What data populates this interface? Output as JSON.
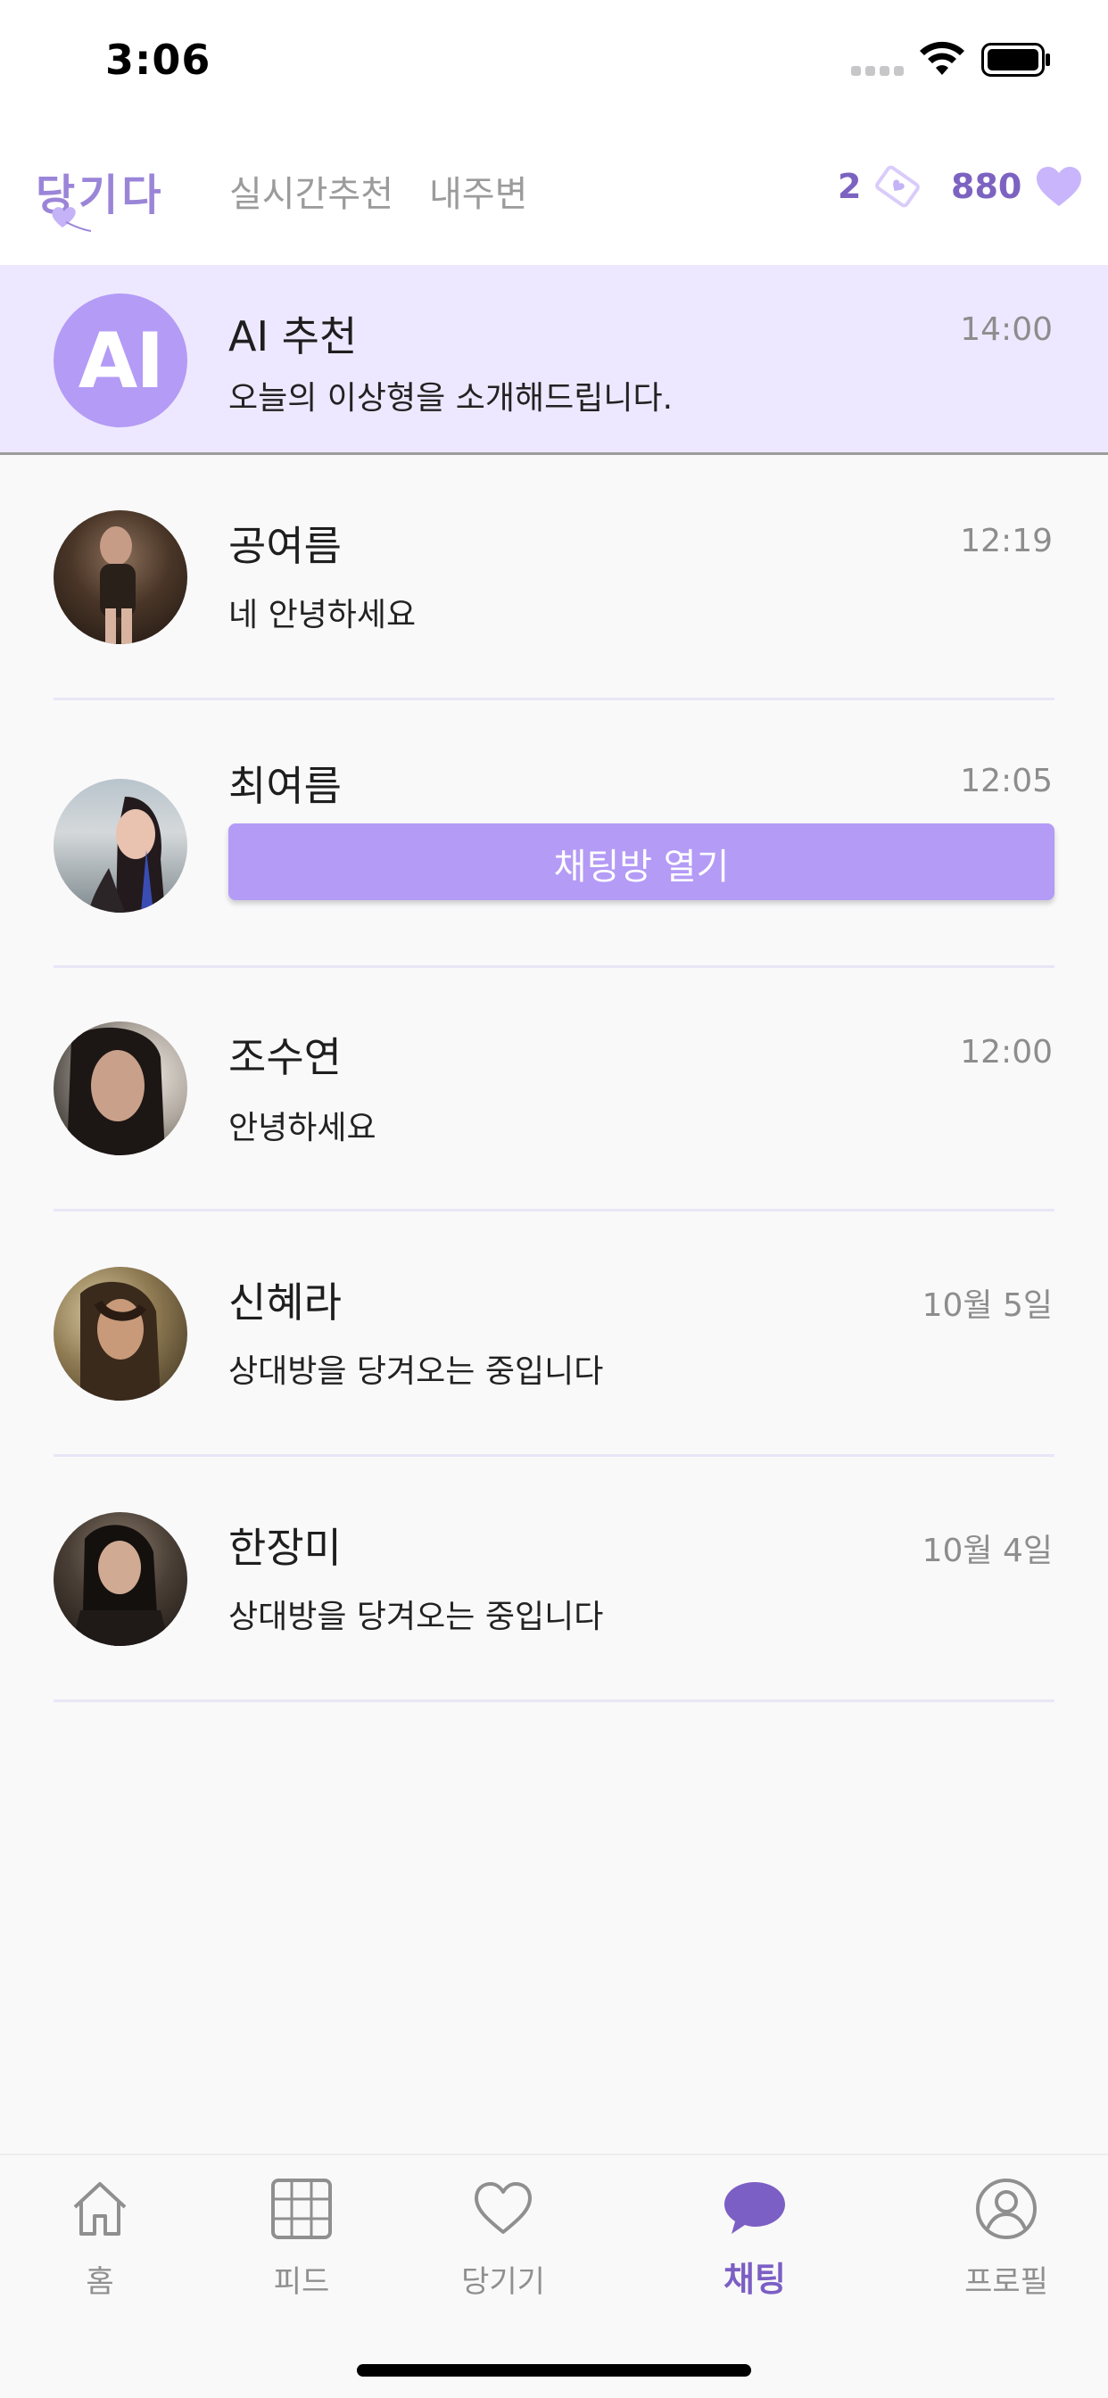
{
  "status_bar": {
    "time": "3:06"
  },
  "header": {
    "logo_text": "당기다",
    "tabs": [
      "실시간추천",
      "내주변"
    ],
    "ticket_count": "2",
    "heart_count": "880"
  },
  "ai_row": {
    "avatar_text": "AI",
    "name": "AI 추천",
    "message": "오늘의 이상형을 소개해드립니다.",
    "time": "14:00"
  },
  "chats": [
    {
      "name": "공여름",
      "message": "네 안녕하세요",
      "time": "12:19"
    },
    {
      "name": "최여름",
      "button_label": "채팅방 열기",
      "time": "12:05"
    },
    {
      "name": "조수연",
      "message": "안녕하세요",
      "time": "12:00"
    },
    {
      "name": "신혜라",
      "message": "상대방을 당겨오는 중입니다",
      "time": "10월 5일"
    },
    {
      "name": "한장미",
      "message": "상대방을 당겨오는 중입니다",
      "time": "10월 4일"
    }
  ],
  "tabbar": {
    "items": [
      {
        "label": "홈",
        "icon": "home-icon"
      },
      {
        "label": "피드",
        "icon": "grid-icon"
      },
      {
        "label": "당기기",
        "icon": "heart-outline-icon"
      },
      {
        "label": "채팅",
        "icon": "chat-bubble-icon",
        "active": true
      },
      {
        "label": "프로필",
        "icon": "profile-icon"
      }
    ]
  },
  "colors": {
    "accent": "#b49bf6",
    "accent_dark": "#7c63c1",
    "ai_row_bg": "#ede8ff"
  }
}
